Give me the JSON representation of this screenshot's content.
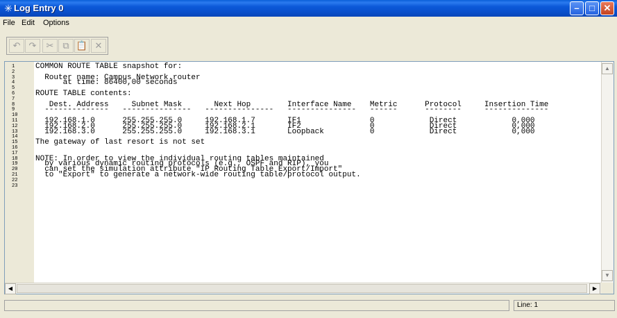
{
  "window": {
    "title": "Log Entry 0",
    "icon": "star-icon",
    "controls": [
      "minimize-icon",
      "maximize-icon",
      "close-icon"
    ]
  },
  "menu": [
    "File",
    "Edit",
    "Options"
  ],
  "toolbar": {
    "buttons": [
      "undo-icon",
      "redo-icon",
      "cut-icon",
      "copy-icon",
      "paste-icon",
      "delete-icon"
    ]
  },
  "editor": {
    "line_numbers": [
      "1",
      "2",
      "3",
      "4",
      "5",
      "6",
      "7",
      "8",
      "9",
      "10",
      "11",
      "12",
      "13",
      "14",
      "15",
      "16",
      "17",
      "18",
      "19",
      "20",
      "21",
      "22",
      "23"
    ],
    "lines": [
      "COMMON ROUTE TABLE snapshot for:",
      "",
      "  Router name: Campus Network.router",
      "      at time: 86400,00 seconds",
      "",
      "ROUTE TABLE contents:",
      "",
      "   Dest. Address     Subnet Mask       Next Hop        Interface Name    Metric      Protocol     Insertion Time",
      "  --------------   ---------------   ---------------   ---------------   ------      --------     --------------",
      "",
      "  192.168.1.0      255.255.255.0     192.168.1.7       IF1               0            Direct            0,000",
      "  192.168.2.0      255.255.255.0     192.168.2.1       IF2               0            Direct            0,000",
      "  192.168.3.0      255.255.255.0     192.168.3.1       Loopback          0            Direct            0,000",
      "",
      "The gateway of last resort is not set",
      "",
      "",
      "NOTE: In order to view the individual routing tables maintained",
      "  by various dynamic routing protocols (e.g., OSPF and RIP), you",
      "  can set the simulation attribute \"IP Routing Table Export/Import\"",
      "  to \"Export\" to generate a network-wide routing table/protocol output.",
      "",
      ""
    ]
  },
  "status": {
    "left": "",
    "line": "Line: 1"
  }
}
